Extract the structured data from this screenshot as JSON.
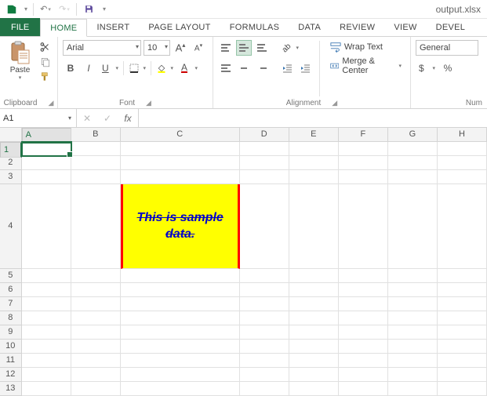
{
  "titlebar": {
    "filename": "output.xlsx"
  },
  "qat": {
    "undo": "↶",
    "redo": "↷",
    "customize": "▾"
  },
  "tabs": {
    "file": "FILE",
    "items": [
      "HOME",
      "INSERT",
      "PAGE LAYOUT",
      "FORMULAS",
      "DATA",
      "REVIEW",
      "VIEW",
      "DEVEL"
    ],
    "active": 0
  },
  "ribbon": {
    "clipboard": {
      "paste": "Paste",
      "label": "Clipboard"
    },
    "font": {
      "name": "Arial",
      "size": "10",
      "grow": "A",
      "shrink": "A",
      "bold": "B",
      "italic": "I",
      "underline": "U",
      "fontcolor": "A",
      "label": "Font"
    },
    "alignment": {
      "wrap": "Wrap Text",
      "merge": "Merge & Center",
      "label": "Alignment"
    },
    "number": {
      "format": "General",
      "currency": "$",
      "percent": "%",
      "label": "Num"
    }
  },
  "formulabar": {
    "namebox": "A1",
    "cancel": "✕",
    "enter": "✓",
    "fx": "fx",
    "formula": ""
  },
  "grid": {
    "cols": [
      "A",
      "B",
      "C",
      "D",
      "E",
      "F",
      "G",
      "H"
    ],
    "rows": [
      "1",
      "2",
      "3",
      "4",
      "5",
      "6",
      "7",
      "8",
      "9",
      "10",
      "11",
      "12",
      "13"
    ],
    "active": "A1",
    "sample_text": "This is sample data."
  }
}
